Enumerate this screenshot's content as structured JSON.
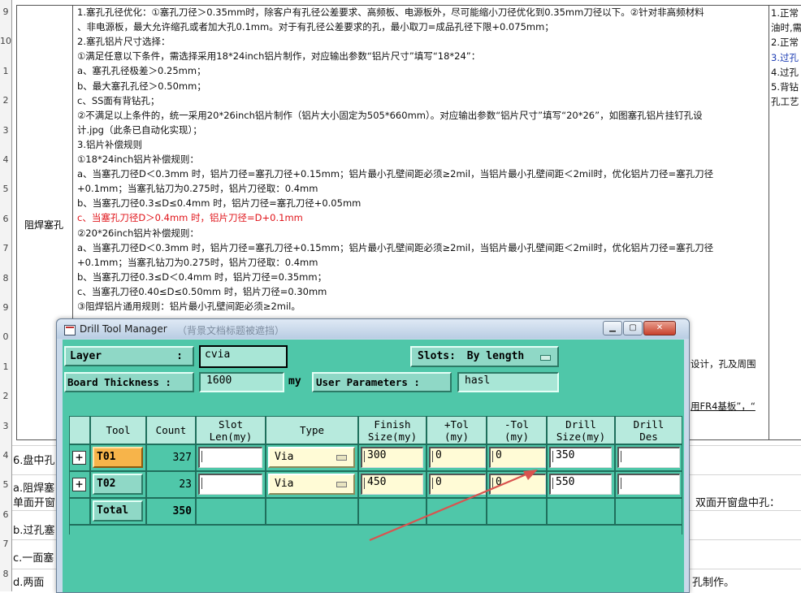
{
  "row_numbers": [
    "9",
    "10",
    "1",
    "2",
    "3",
    "4",
    "5",
    "6",
    "7",
    "8",
    "9",
    "0",
    "1",
    "2",
    "3",
    "4",
    "5",
    "6",
    "7",
    "8"
  ],
  "cell_label": "阻焊塞孔",
  "body_lines": [
    {
      "text": "1.塞孔孔径优化：①塞孔刀径＞0.35mm时，除客户有孔径公差要求、高频板、电源板外，尽可能缩小刀径优化到0.35mm刀径以下。②针对非高频材料",
      "red": false
    },
    {
      "text": "、非电源板，最大允许缩孔或者加大孔0.1mm。对于有孔径公差要求的孔，最小取刀=成品孔径下限+0.075mm；",
      "red": false
    },
    {
      "text": "2.塞孔铝片尺寸选择：",
      "red": false
    },
    {
      "text": "①满足任意以下条件，需选择采用18*24inch铝片制作，对应输出参数“铝片尺寸”填写“18*24”：",
      "red": false
    },
    {
      "text": "a、塞孔孔径极差＞0.25mm；",
      "red": false
    },
    {
      "text": "b、最大塞孔孔径＞0.50mm；",
      "red": false
    },
    {
      "text": "c、SS面有背钻孔；",
      "red": false
    },
    {
      "text": "②不满足以上条件的，统一采用20*26inch铝片制作（铝片大小固定为505*660mm）。对应输出参数“铝片尺寸”填写“20*26”，如图塞孔铝片挂钉孔设",
      "red": false
    },
    {
      "text": "计.jpg（此条已自动化实现）；",
      "red": false
    },
    {
      "text": "3.铝片补偿规则",
      "red": false
    },
    {
      "text": "①18*24inch铝片补偿规则：",
      "red": false
    },
    {
      "text": "a、当塞孔刀径D＜0.3mm 时，铝片刀径=塞孔刀径+0.15mm；铝片最小孔壁间距必须≥2mil，当铝片最小孔壁间距＜2mil时，优化铝片刀径=塞孔刀径",
      "red": false
    },
    {
      "text": "+0.1mm；当塞孔钻刀为0.275时，铝片刀径取：0.4mm",
      "red": false
    },
    {
      "text": "b、当塞孔刀径0.3≤D≤0.4mm 时，铝片刀径=塞孔刀径+0.05mm",
      "red": false
    },
    {
      "text": "c、当塞孔刀径D＞0.4mm 时，铝片刀径=D+0.1mm",
      "red": true
    },
    {
      "text": "②20*26inch铝片补偿规则：",
      "red": false
    },
    {
      "text": "a、当塞孔刀径D＜0.3mm 时，铝片刀径=塞孔刀径+0.15mm；铝片最小孔壁间距必须≥2mil，当铝片最小孔壁间距＜2mil时，优化铝片刀径=塞孔刀径",
      "red": false
    },
    {
      "text": "+0.1mm；当塞孔钻刀为0.275时，铝片刀径取：0.4mm",
      "red": false
    },
    {
      "text": "b、当塞孔刀径0.3≤D＜0.4mm 时，铝片刀径=0.35mm；",
      "red": false
    },
    {
      "text": "c、当塞孔刀径0.40≤D≤0.50mm 时，铝片刀径=0.30mm",
      "red": false
    },
    {
      "text": "③阻焊铝片通用规则：铝片最小孔壁间距必须≥2mil。",
      "red": false
    }
  ],
  "right_col_lines": [
    {
      "text": "1.正常",
      "blue": false
    },
    {
      "text": "油时,需",
      "blue": false
    },
    {
      "text": "2.正常",
      "blue": false
    },
    {
      "text": "3.过孔",
      "blue": false
    },
    {
      "text": "4.过孔",
      "blue": false
    },
    {
      "text": "5.背钻",
      "blue": false
    },
    {
      "text": "孔工艺",
      "blue": false
    }
  ],
  "behind_window_text": {
    "right1": "设计，孔及周围",
    "right2": "用FR4基板”，“"
  },
  "lower_rows": {
    "r1": "6.盘中孔",
    "r2": "a.阻焊塞",
    "r3": "单面开窗",
    "r3_right": "双面开窗盘中孔：",
    "r4": "b.过孔塞",
    "r5": "c.一面塞",
    "r6": "d.两面",
    "r6_right": "孔制作。"
  },
  "window": {
    "title": "Drill Tool Manager",
    "faded_title": "（背景文档标题被遮挡）",
    "layer_label": "Layer",
    "layer_colon": ":",
    "layer_value": "cvia",
    "slots_label": "Slots:",
    "slots_value": "By length",
    "board_thickness_label": "Board Thickness  :",
    "board_thickness_value": "1600",
    "board_thickness_unit": "my",
    "user_params_label": "User Parameters  :",
    "user_params_value": "hasl"
  },
  "columns": [
    {
      "id": "tool",
      "line1": "Tool",
      "line2": ""
    },
    {
      "id": "count",
      "line1": "Count",
      "line2": ""
    },
    {
      "id": "slot",
      "line1": "Slot",
      "line2": "Len(my)"
    },
    {
      "id": "type",
      "line1": "Type",
      "line2": ""
    },
    {
      "id": "finish",
      "line1": "Finish",
      "line2": "Size(my)"
    },
    {
      "id": "ptol",
      "line1": "+Tol",
      "line2": "(my)"
    },
    {
      "id": "ntol",
      "line1": "-Tol",
      "line2": "(my)"
    },
    {
      "id": "drill",
      "line1": "Drill",
      "line2": "Size(my)"
    },
    {
      "id": "des",
      "line1": "Drill",
      "line2": "Des"
    }
  ],
  "rows": [
    {
      "tool": "T01",
      "count": "327",
      "slot": "",
      "type": "Via",
      "finish": "300",
      "ptol": "0",
      "ntol": "0",
      "drill": "350",
      "des": ""
    },
    {
      "tool": "T02",
      "count": "23",
      "slot": "",
      "type": "Via",
      "finish": "450",
      "ptol": "0",
      "ntol": "0",
      "drill": "550",
      "des": ""
    }
  ],
  "total": {
    "label": "Total",
    "count": "350"
  },
  "colors": {
    "client_bg": "#4fc7a9",
    "tool_selected": "#f7b44a",
    "input_yellow": "#fffbd6",
    "annotation_arrow": "#d9534f",
    "red_text": "#e0141a"
  }
}
